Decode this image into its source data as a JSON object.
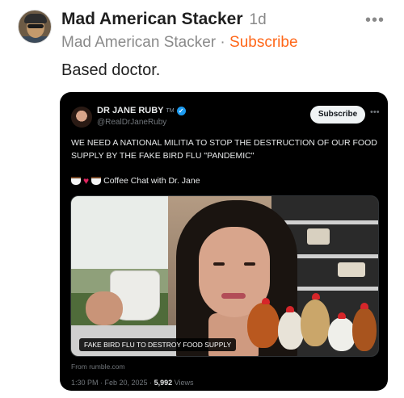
{
  "post": {
    "author": "Mad American Stacker",
    "time": "1d",
    "publication": "Mad American Stacker",
    "separator": "·",
    "subscribe_label": "Subscribe",
    "text": "Based doctor.",
    "more_label": "•••"
  },
  "embed": {
    "name": "DR JANE RUBY",
    "tm": "TM",
    "verified_glyph": "✓",
    "handle": "@RealDrJaneRuby",
    "subscribe_label": "Subscribe",
    "more_label": "•••",
    "text": "WE NEED A NATIONAL MILITIA TO STOP THE DESTRUCTION OF OUR FOOD SUPPLY BY THE FAKE BIRD FLU \"PANDEMIC\"",
    "coffee_text": "Coffee Chat with Dr. Jane",
    "media_caption": "FAKE BIRD FLU TO DESTROY FOOD SUPPLY",
    "from_text": "From rumble.com",
    "timestamp": "1:30 PM · Feb 20, 2025 ·",
    "views_count": "5,992",
    "views_label": "Views"
  },
  "colors": {
    "accent": "#ff6719",
    "verified": "#1d9bf0"
  }
}
